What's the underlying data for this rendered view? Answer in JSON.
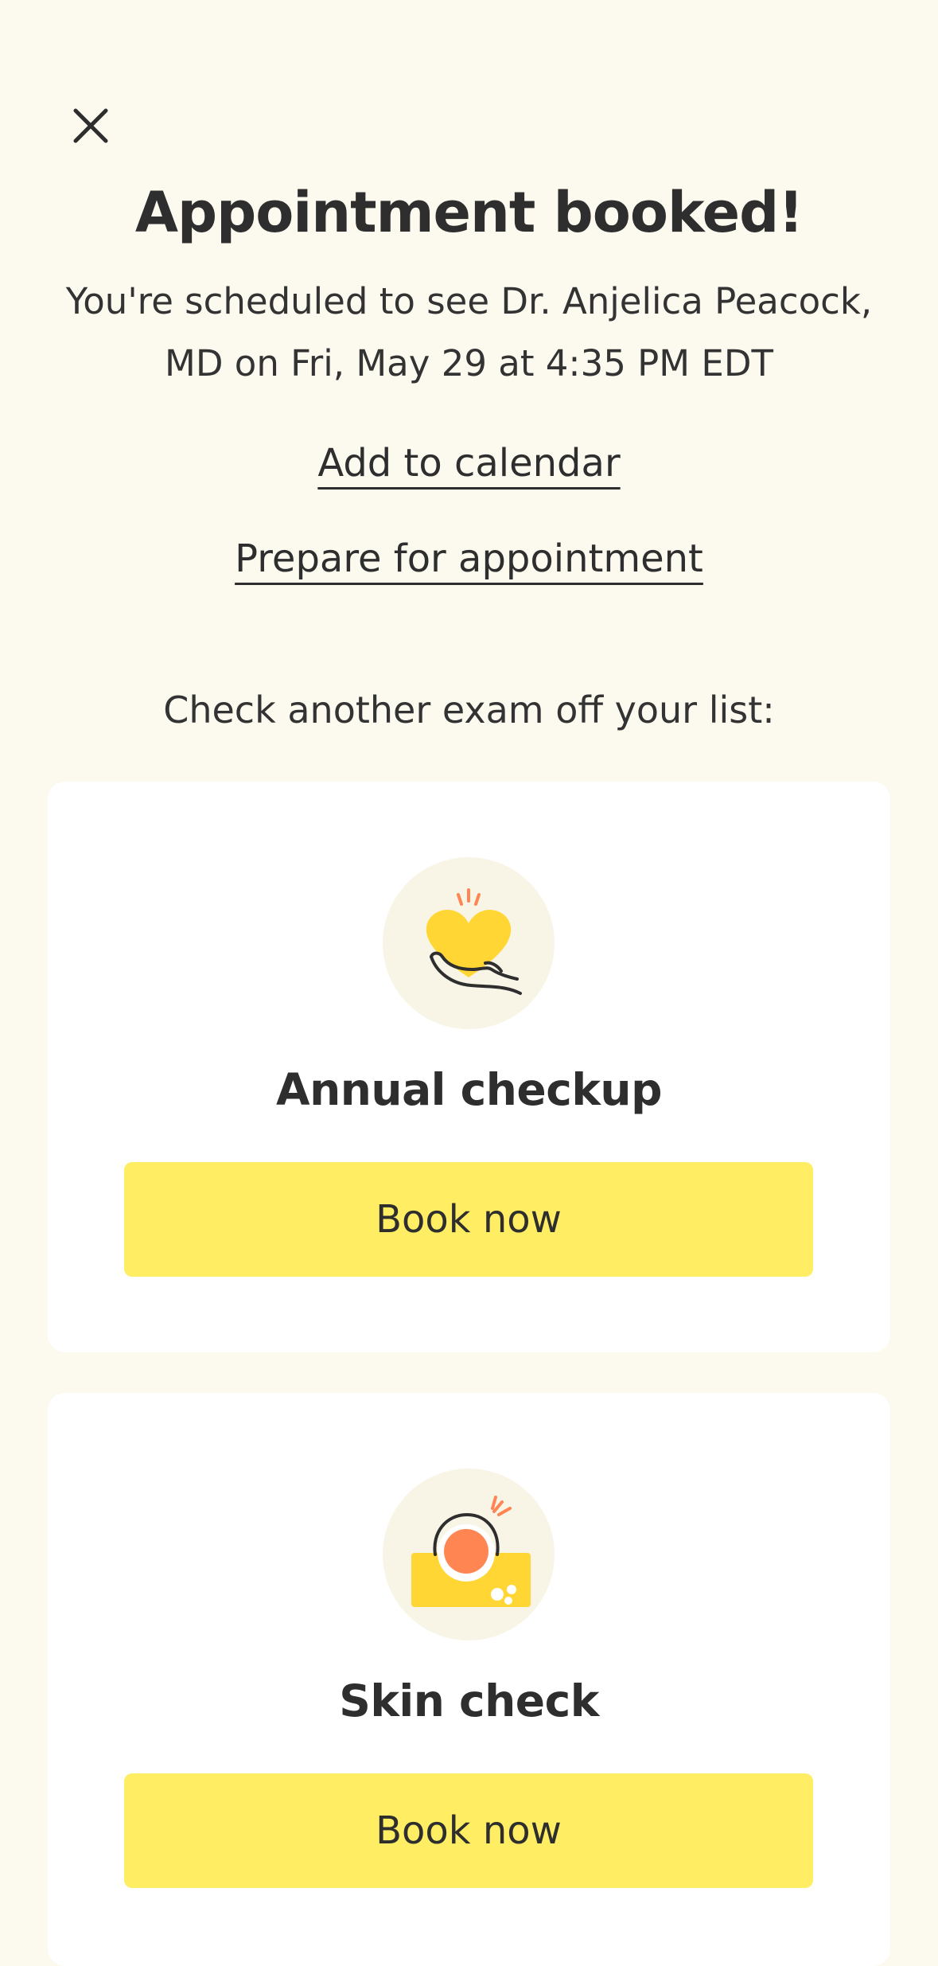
{
  "header": {
    "close_icon": "close-icon",
    "title": "Appointment booked!",
    "subtitle": "You're scheduled to see Dr. Anjelica Peacock, MD on Fri, May 29 at 4:35 PM EDT"
  },
  "links": {
    "add_to_calendar": "Add to calendar",
    "prepare": "Prepare for appointment"
  },
  "section": {
    "heading": "Check another exam off your list:"
  },
  "cards": [
    {
      "icon": "heart-in-hand-icon",
      "title": "Annual checkup",
      "button_label": "Book now"
    },
    {
      "icon": "skin-check-icon",
      "title": "Skin check",
      "button_label": "Book now"
    }
  ],
  "colors": {
    "background": "#FCFAEF",
    "card": "#FFFFFF",
    "button": "#FFED63",
    "icon_circle": "#F8F5E6",
    "heart": "#FFD633",
    "orange": "#FF8552",
    "text": "#2E2E2E"
  }
}
